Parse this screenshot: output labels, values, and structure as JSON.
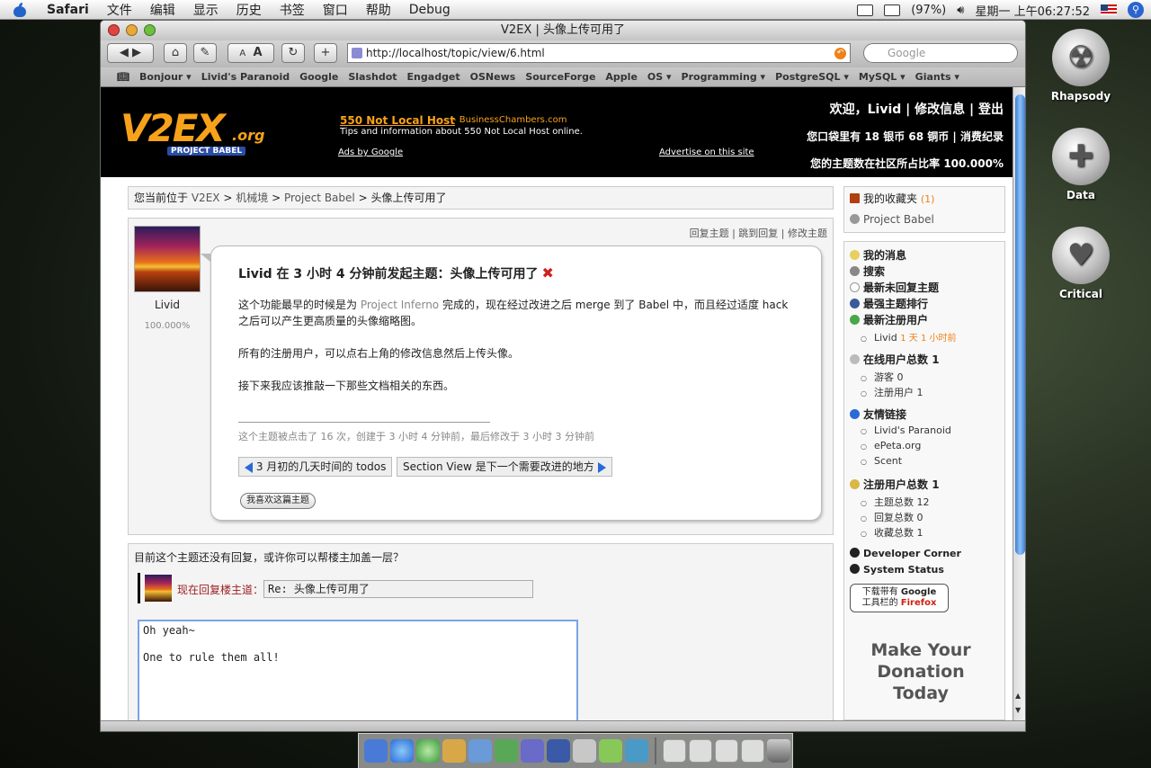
{
  "menubar": {
    "app": "Safari",
    "items": [
      "文件",
      "编辑",
      "显示",
      "历史",
      "书签",
      "窗口",
      "帮助",
      "Debug"
    ],
    "battery": "(97%)",
    "clock": "星期一 上午06:27:52"
  },
  "window": {
    "title": "V2EX | 头像上传可用了",
    "url": "http://localhost/topic/view/6.html",
    "search_placeholder": "Google",
    "toolbar": {
      "font_small": "A",
      "font_large": "A",
      "reload": "↻",
      "add": "+"
    },
    "bookmarks": [
      "Bonjour ▾",
      "Livid's Paranoid",
      "Google",
      "Slashdot",
      "Engadget",
      "OSNews",
      "SourceForge",
      "Apple",
      "OS ▾",
      "Programming ▾",
      "PostgreSQL ▾",
      "MySQL ▾",
      "Giants ▾"
    ]
  },
  "header": {
    "logo": "V2EX",
    "logo_org": ".org",
    "logo_sub": "PROJECT BABEL",
    "ad_title": "550 Not Local Host",
    "ad_domain": "- BusinessChambers.com",
    "ad_desc": "Tips and information about 550 Not Local Host online.",
    "ads_by_google": "Ads by Google",
    "advertise": "Advertise on this site",
    "welcome": "欢迎，Livid | 修改信息 | 登出",
    "wallet": "您口袋里有 18 银币 68 铜币 | 消费纪录",
    "share": "您的主题数在社区所占比率 100.000%"
  },
  "breadcrumb": {
    "prefix": "您当前位于",
    "l1": "V2EX",
    "l2": "机械境",
    "l3": "Project Babel",
    "current": "头像上传可用了",
    "sep": ">"
  },
  "post": {
    "author": "Livid",
    "percent": "100.000%",
    "actions": "回复主题 | 跳到回复 | 修改主题",
    "title": "Livid 在 3 小时 4 分钟前发起主题：头像上传可用了",
    "close_icon": "✖",
    "p1_before": "这个功能最早的时候是为",
    "p1_link": "Project Inferno",
    "p1_after": "完成的，现在经过改进之后 merge 到了 Babel 中，而且经过适度 hack 之后可以产生更高质量的头像缩略图。",
    "p2": "所有的注册用户，可以点右上角的修改信息然后上传头像。",
    "p3": "接下来我应该推敲一下那些文档相关的东西。",
    "meta": "这个主题被点击了 16 次，创建于 3 小时 4 分钟前，最后修改于 3 小时 3 分钟前",
    "prev": "3 月初的几天时间的 todos",
    "next": "Section View 是下一个需要改进的地方",
    "like": "我喜欢这篇主题"
  },
  "reply": {
    "hint": "目前这个主题还没有回复，或许你可以帮楼主加盖一层？",
    "label": "现在回复楼主道：",
    "title_value": "Re: 头像上传可用了",
    "body": "Oh yeah~\n\nOne to rule them all!"
  },
  "sidebar": {
    "fav": "我的收藏夹",
    "fav_count": "(1)",
    "fav_item": "Project Babel",
    "messages": "我的消息",
    "search": "搜索",
    "unreplied": "最新未回复主题",
    "top": "最强主题排行",
    "newusers": "最新注册用户",
    "newuser_name": "Livid",
    "newuser_time": "1 天 1 小时前",
    "online": "在线用户总数",
    "online_count": "1",
    "guests": "游客 0",
    "registered_online": "注册用户 1",
    "links": "友情链接",
    "link1": "Livid's Paranoid",
    "link2": "ePeta.org",
    "link3": "Scent",
    "reg_total": "注册用户总数",
    "reg_total_count": "1",
    "topics_total": "主题总数 12",
    "replies_total": "回复总数 0",
    "favs_total": "收藏总数 1",
    "dev": "Developer Corner",
    "status": "System Status",
    "ff_line1": "下载带有",
    "ff_google": "Google",
    "ff_line2": "工具栏的",
    "ff_firefox": "Firefox",
    "donate1": "Make Your",
    "donate2": "Donation",
    "donate3": "Today"
  },
  "desktop": {
    "icon1": "Rhapsody",
    "icon2": "Data",
    "icon3": "Critical"
  },
  "colors": {
    "accent": "#f7a21a",
    "link": "#555555",
    "scroll": "#3f7fd8"
  }
}
